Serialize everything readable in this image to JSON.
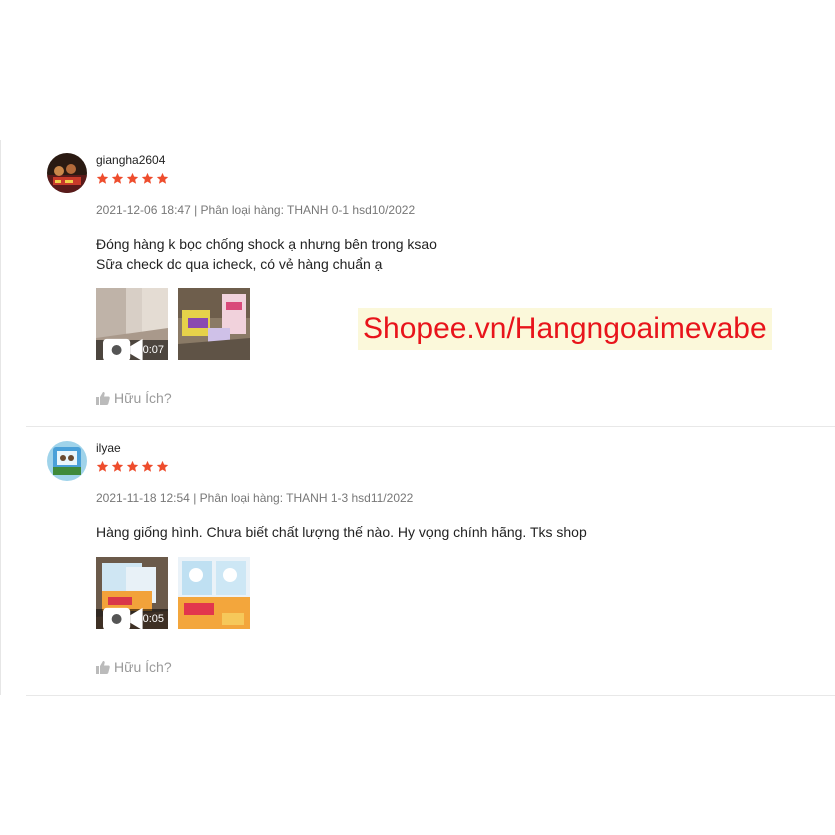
{
  "reviews": [
    {
      "username": "giangha2604",
      "rating": 5,
      "meta": "2021-12-06 18:47 | Phân loại hàng: THANH 0-1 hsd10/2022",
      "comment_lines": [
        "Đóng hàng k bọc chống shock ạ nhưng bên trong ksao",
        "Sữa check dc qua icheck, có vẻ hàng chuẩn ạ"
      ],
      "media": [
        {
          "type": "video",
          "duration": "0:07"
        },
        {
          "type": "photo"
        }
      ],
      "helpful_label": "Hữu Ích?"
    },
    {
      "username": "ilyae",
      "rating": 5,
      "meta": "2021-11-18 12:54 | Phân loại hàng: THANH 1-3 hsd11/2022",
      "comment_lines": [
        "Hàng giống hình. Chưa biết chất lượng thế nào. Hy vọng chính hãng. Tks shop"
      ],
      "media": [
        {
          "type": "video",
          "duration": "0:05"
        },
        {
          "type": "photo"
        }
      ],
      "helpful_label": "Hữu Ích?"
    }
  ],
  "watermark": "Shopee.vn/Hangngoaimevabe",
  "colors": {
    "star": "#ee4d2d",
    "watermark_text": "#e8141b",
    "watermark_bg": "#fbf8da",
    "muted": "#9a9a9a"
  },
  "icons": [
    "star-icon",
    "video-camera-icon",
    "thumbs-up-icon"
  ]
}
